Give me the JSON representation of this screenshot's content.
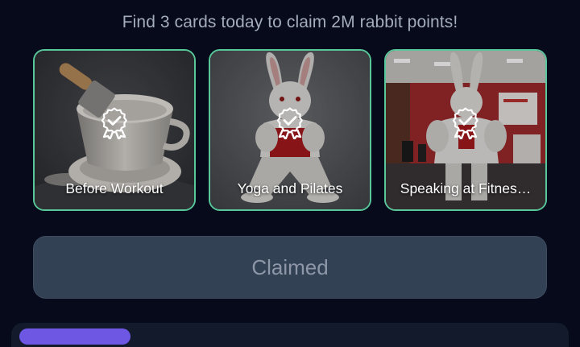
{
  "header": {
    "headline": "Find 3 cards today to claim 2M rabbit points!"
  },
  "cards": [
    {
      "label": "Before Workout",
      "badge_icon": "award-check-icon",
      "border_color": "#58c79a"
    },
    {
      "label": "Yoga and Pilates",
      "badge_icon": "award-check-icon",
      "border_color": "#58c79a"
    },
    {
      "label": "Speaking at Fitnes…",
      "badge_icon": "award-check-icon",
      "border_color": "#58c79a"
    }
  ],
  "claim_button": {
    "label": "Claimed"
  },
  "colors": {
    "background": "#060a1a",
    "accent": "#58c79a",
    "button_bg": "#334155",
    "tab_accent": "#6d57e3"
  }
}
